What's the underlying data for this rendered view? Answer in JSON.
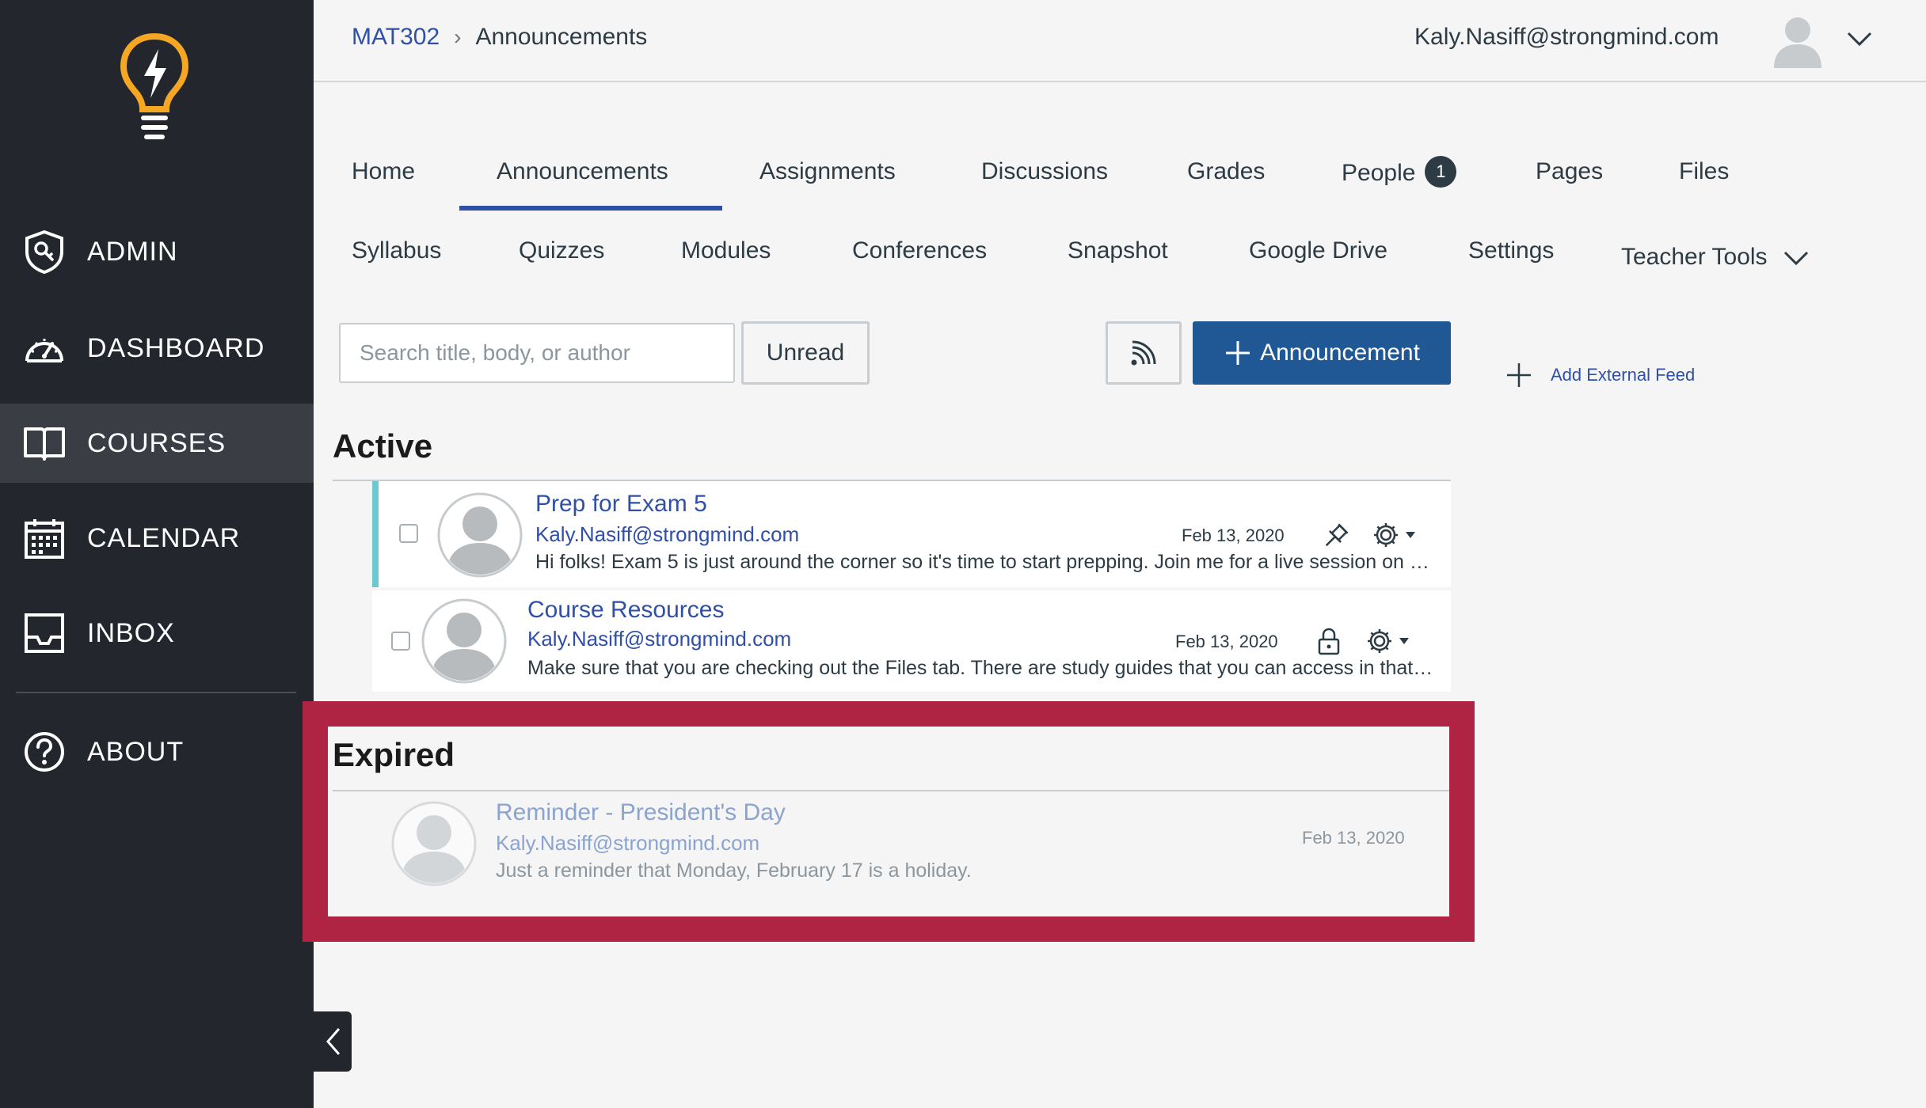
{
  "sidebar": {
    "items": [
      {
        "label": "ADMIN",
        "icon": "admin-shield-icon"
      },
      {
        "label": "DASHBOARD",
        "icon": "dashboard-gauge-icon"
      },
      {
        "label": "COURSES",
        "icon": "book-icon"
      },
      {
        "label": "CALENDAR",
        "icon": "calendar-icon"
      },
      {
        "label": "INBOX",
        "icon": "inbox-icon"
      },
      {
        "label": "ABOUT",
        "icon": "help-icon"
      }
    ],
    "active": "COURSES"
  },
  "header": {
    "breadcrumb": {
      "course": "MAT302",
      "current": "Announcements"
    },
    "user_email": "Kaly.Nasiff@strongmind.com"
  },
  "tabs": {
    "row1": [
      "Home",
      "Announcements",
      "Assignments",
      "Discussions",
      "Grades",
      "People",
      "Pages",
      "Files"
    ],
    "row2": [
      "Syllabus",
      "Quizzes",
      "Modules",
      "Conferences",
      "Snapshot",
      "Google Drive",
      "Settings",
      "Teacher Tools"
    ],
    "people_badge": "1",
    "active": "Announcements"
  },
  "toolbar": {
    "search_placeholder": "Search title, body, or author",
    "unread_label": "Unread",
    "add_label": "Announcement",
    "external_feed_label": "Add External Feed"
  },
  "sections": {
    "active_title": "Active",
    "expired_title": "Expired"
  },
  "announcements": {
    "active": [
      {
        "title": "Prep for Exam 5",
        "author": "Kaly.Nasiff@strongmind.com",
        "date": "Feb 13, 2020",
        "body": "Hi folks! Exam 5 is just around the corner so it's time to start prepping. Join me for a live session on …",
        "status_icon": "pin-icon"
      },
      {
        "title": "Course Resources",
        "author": "Kaly.Nasiff@strongmind.com",
        "date": "Feb 13, 2020",
        "body": "Make sure that you are checking out the Files tab. There are study guides that you can access in that …",
        "status_icon": "lock-icon"
      }
    ],
    "expired": [
      {
        "title": "Reminder - President's Day",
        "author": "Kaly.Nasiff@strongmind.com",
        "date": "Feb 13, 2020",
        "body": "Just a reminder that Monday, February 17 is a holiday."
      }
    ]
  },
  "colors": {
    "sidebar_bg": "#23262d",
    "accent_blue": "#2f4fa8",
    "button_blue": "#1f5894",
    "logo_yellow": "#f5a623",
    "highlight_red": "#ae2442",
    "unread_bar": "#6cc9d2"
  }
}
